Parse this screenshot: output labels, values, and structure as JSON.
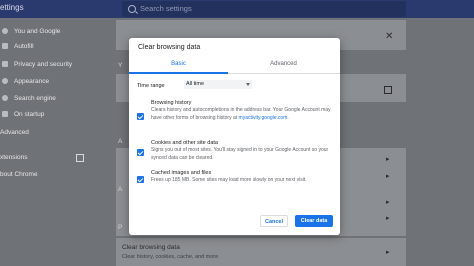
{
  "app": {
    "title": "ettings"
  },
  "search": {
    "placeholder": "Search settings"
  },
  "sidebar": {
    "items": [
      {
        "label": "You and Google"
      },
      {
        "label": "Autofill"
      },
      {
        "label": "Privacy and security"
      },
      {
        "label": "Appearance"
      },
      {
        "label": "Search engine"
      },
      {
        "label": "On startup"
      },
      {
        "label": "Advanced"
      },
      {
        "label": "xtensions"
      },
      {
        "label": "bout Chrome"
      }
    ]
  },
  "background": {
    "section_y": "Y",
    "section_a1": "A",
    "section_a2": "A",
    "section_p": "P",
    "footer_title": "Clear browsing data",
    "footer_desc": "Clear history, cookies, cache, and more"
  },
  "dialog": {
    "title": "Clear browsing data",
    "tabs": [
      {
        "label": "Basic"
      },
      {
        "label": "Advanced"
      }
    ],
    "time_range_label": "Time range",
    "time_range_value": "All time",
    "options": [
      {
        "title": "Browsing history",
        "desc": "Clears history and autocompletions in the address bar. Your Google Account may have other forms of browsing history at",
        "link": "myactivity.google.com",
        "desc_end": "."
      },
      {
        "title": "Cookies and other site data",
        "desc": "Signs you out of most sites. You'll stay signed in to your Google Account so your synced data can be cleared."
      },
      {
        "title": "Cached images and files",
        "desc": "Frees up 185 MB. Some sites may load more slowly on your next visit."
      }
    ],
    "cancel_label": "Cancel",
    "clear_label": "Clear data"
  }
}
